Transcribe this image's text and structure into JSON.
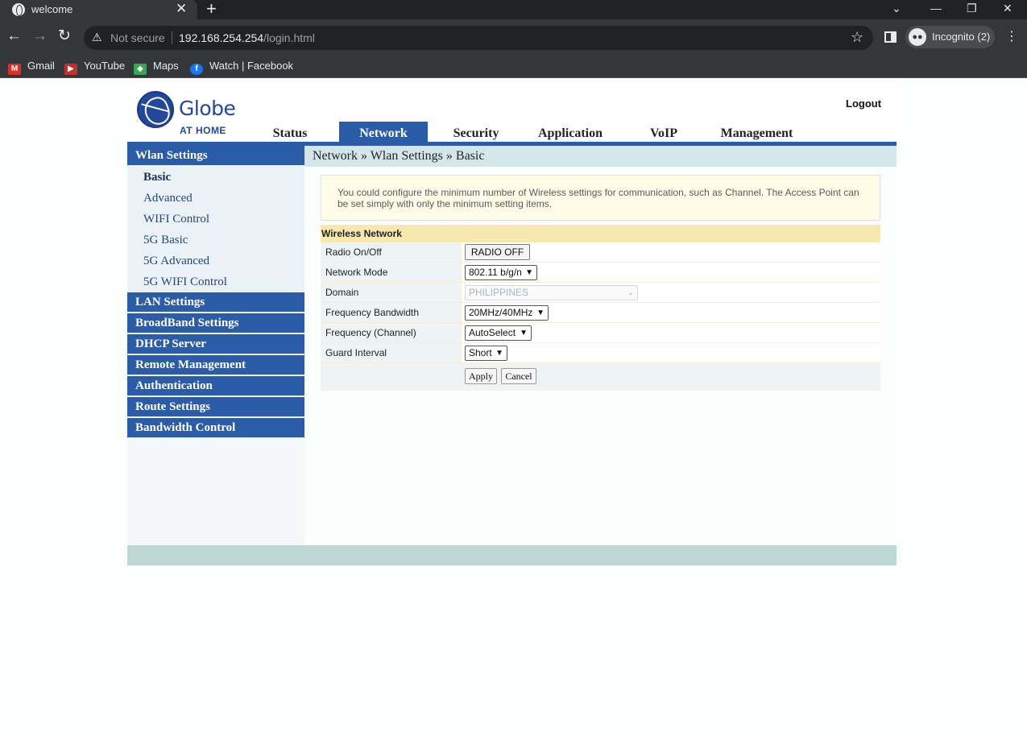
{
  "browser": {
    "tab_title": "welcome",
    "new_tab_glyph": "+",
    "tab_close_glyph": "✕",
    "security_label": "Not secure",
    "url_host": "192.168.254.254",
    "url_path": "/login.html",
    "incognito_label": "Incognito (2)",
    "bookmarks": [
      {
        "label": "Gmail",
        "icon": "gmail-icon",
        "color": "#d93025"
      },
      {
        "label": "YouTube",
        "icon": "youtube-icon",
        "color": "#c4302b"
      },
      {
        "label": "Maps",
        "icon": "maps-icon",
        "color": "#34a853"
      },
      {
        "label": "Watch | Facebook",
        "icon": "facebook-icon",
        "color": "#1877f2"
      }
    ]
  },
  "router": {
    "brand": "Globe",
    "brand_sub": "AT HOME",
    "logout_label": "Logout",
    "main_nav": [
      {
        "label": "Status",
        "active": false
      },
      {
        "label": "Network",
        "active": true
      },
      {
        "label": "Security",
        "active": false
      },
      {
        "label": "Application",
        "active": false
      },
      {
        "label": "VoIP",
        "active": false
      },
      {
        "label": "Management",
        "active": false
      }
    ],
    "sidebar": {
      "section": "Wlan Settings",
      "sub_items": [
        "Basic",
        "Advanced",
        "WIFI Control",
        "5G Basic",
        "5G Advanced",
        "5G WIFI Control"
      ],
      "active_sub": "Basic",
      "sections": [
        "LAN Settings",
        "BroadBand Settings",
        "DHCP Server",
        "Remote Management",
        "Authentication",
        "Route Settings",
        "Bandwidth Control"
      ]
    },
    "breadcrumb": "Network » Wlan Settings » Basic",
    "notice": "You could configure the minimum number of Wireless settings for communication, such as Channel. The Access Point can be set simply with only the minimum setting items.",
    "wireless": {
      "header": "Wireless Network",
      "rows": [
        {
          "label": "Radio On/Off",
          "value": "RADIO OFF"
        },
        {
          "label": "Network Mode",
          "value": "802.11 b/g/n"
        },
        {
          "label": "Domain",
          "value": "PHILIPPINES"
        },
        {
          "label": "Frequency Bandwidth",
          "value": "20MHz/40MHz"
        },
        {
          "label": "Frequency (Channel)",
          "value": "AutoSelect"
        },
        {
          "label": "Guard Interval",
          "value": "Short"
        }
      ],
      "apply_label": "Apply",
      "cancel_label": "Cancel"
    }
  },
  "colors": {
    "brand_blue": "#2a5ca8",
    "notice_bg": "#fffde8",
    "section_header_bg": "#f7e8b0",
    "footer_bar": "#bdd7d4",
    "breadcrumb_bg": "#d4e6ea"
  }
}
